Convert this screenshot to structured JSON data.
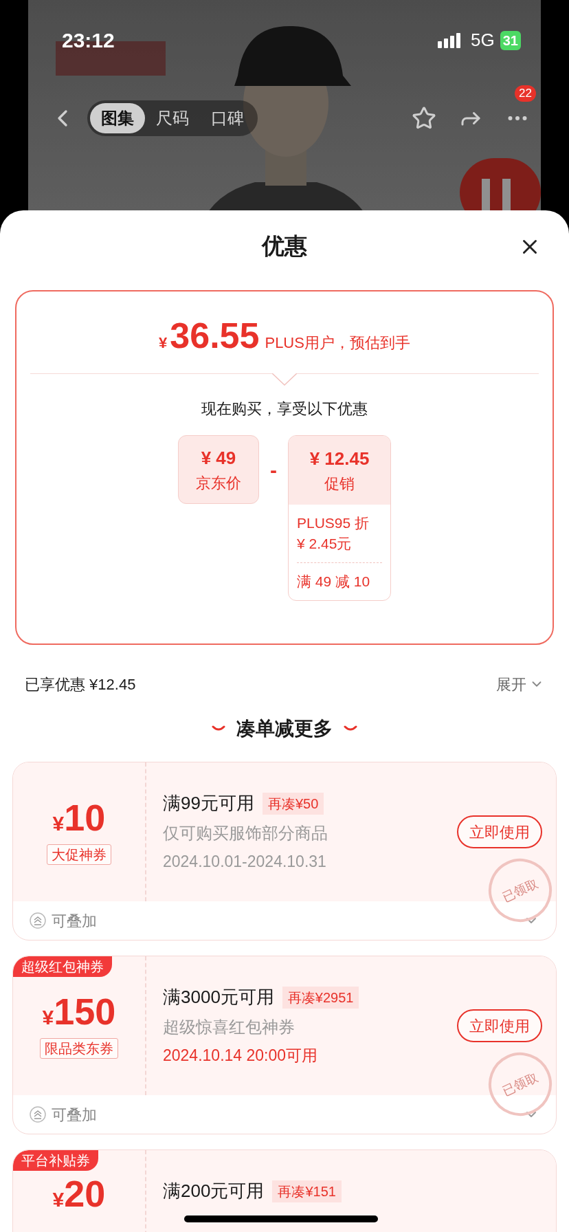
{
  "status_bar": {
    "time": "23:12",
    "network": "5G",
    "battery": "31"
  },
  "nav": {
    "tabs": [
      {
        "label": "图集",
        "selected": true
      },
      {
        "label": "尺码",
        "selected": false
      },
      {
        "label": "口碑",
        "selected": false
      }
    ],
    "more_badge": "22"
  },
  "sheet": {
    "title": "优惠"
  },
  "price_card": {
    "currency": "¥",
    "price": "36.55",
    "caption": "PLUS用户，预估到手",
    "subtitle": "现在购买，享受以下优惠",
    "base": {
      "amount": "¥ 49",
      "label": "京东价"
    },
    "operator": "-",
    "discount": {
      "amount": "¥ 12.45",
      "label": "促销",
      "details": [
        {
          "lines": [
            "PLUS95 折",
            "¥ 2.45元"
          ]
        },
        {
          "lines": [
            "满 49 减 10"
          ]
        }
      ]
    }
  },
  "summary": {
    "text": "已享优惠 ¥12.45",
    "toggle": "展开"
  },
  "section_title": "凑单减更多",
  "coupons": [
    {
      "currency": "¥",
      "amount": "10",
      "label": "大促神券",
      "title": "满99元可用",
      "tag": "再凑¥50",
      "desc": "仅可购买服饰部分商品",
      "date": "2024.10.01-2024.10.31",
      "date_highlight": false,
      "button": "立即使用",
      "stamp": "已领取",
      "stack": "可叠加"
    },
    {
      "badge": "超级红包神券",
      "currency": "¥",
      "amount": "150",
      "label": "限品类东券",
      "title": "满3000元可用",
      "tag": "再凑¥2951",
      "desc": "超级惊喜红包神券",
      "date": "2024.10.14 20:00可用",
      "date_highlight": true,
      "button": "立即使用",
      "stamp": "已领取",
      "stack": "可叠加"
    },
    {
      "badge": "平台补贴券",
      "currency": "¥",
      "amount": "20",
      "title": "满200元可用",
      "tag": "再凑¥151"
    }
  ]
}
